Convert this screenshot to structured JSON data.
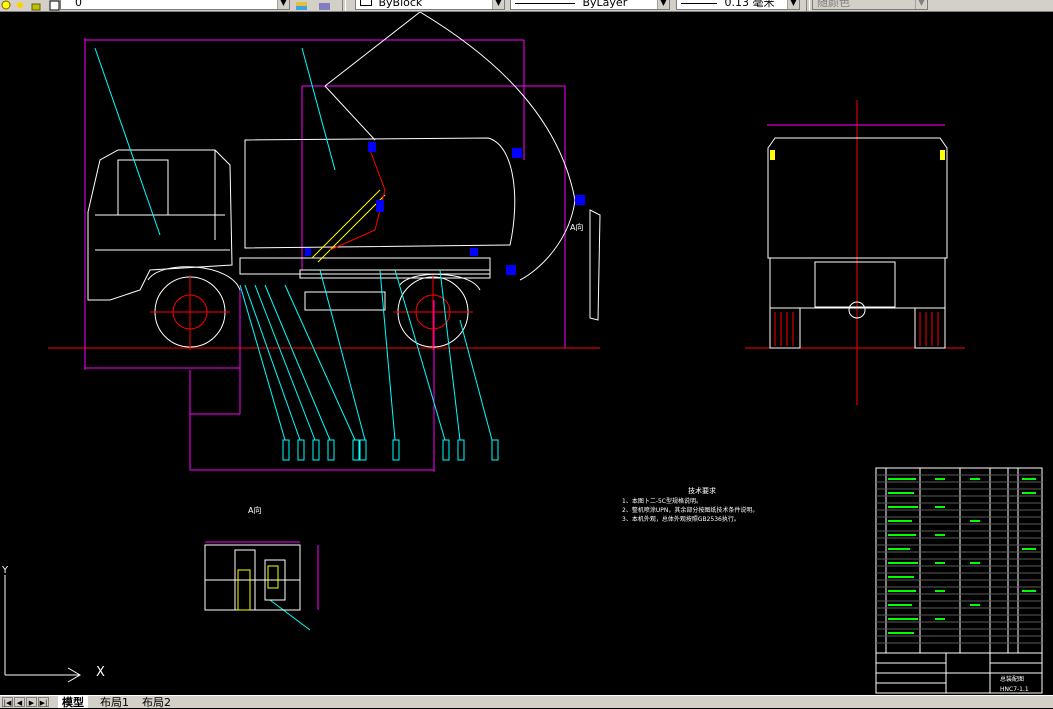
{
  "toolbar": {
    "layer_value": "0",
    "linetype_value": "ByBlock",
    "lineweight_layer_value": "ByLayer",
    "lineweight_mm_value": "0.13 毫米",
    "color_value": "随颜色"
  },
  "drawing": {
    "section_label": "A向",
    "section_marker": "A向",
    "tech_title": "技术要求",
    "tech_notes": [
      "1、本图卜二-5C型规格说明。",
      "2、整机喷涂UPN，其余部分按图纸技术条件说明。",
      "3、本机外观，总体外观按照GB2536执行。"
    ],
    "title_block": {
      "name": "总装配图",
      "code": "HNC7-1.1"
    },
    "ucs_y": "Y",
    "ucs_x": "X"
  },
  "tabs": [
    {
      "label": "模型"
    },
    {
      "label": "布局1"
    },
    {
      "label": "布局2"
    }
  ],
  "colors": {
    "background": "#000000",
    "magenta": "#ff00ff",
    "cyan": "#00ffff",
    "red": "#ff0000",
    "white": "#ffffff",
    "blue": "#0000ff",
    "yellow": "#ffff00",
    "green": "#00ff00"
  }
}
